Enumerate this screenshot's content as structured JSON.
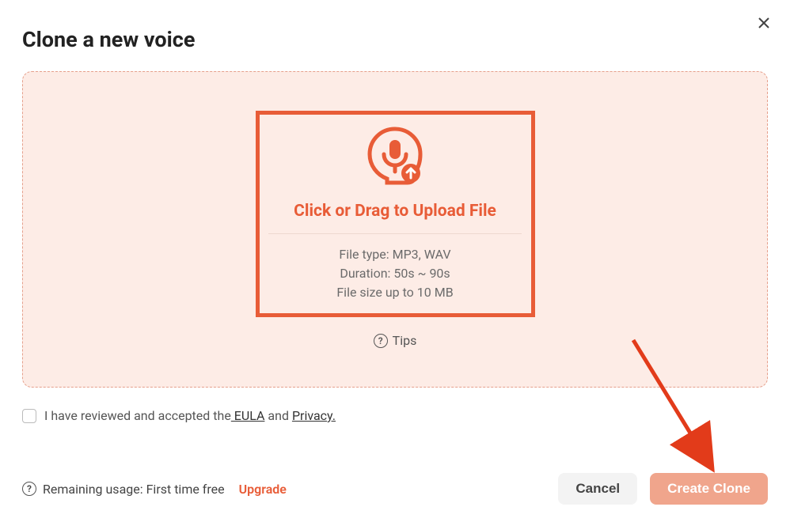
{
  "modal": {
    "title": "Clone a new voice",
    "upload": {
      "title": "Click or Drag to Upload File",
      "req_filetype": "File type: MP3, WAV",
      "req_duration": "Duration: 50s ~ 90s",
      "req_filesize": "File size up to 10 MB"
    },
    "tips_label": "Tips",
    "agree": {
      "prefix": "I have reviewed and accepted the",
      "eula": " EULA",
      "mid": " and ",
      "privacy": "Privacy."
    }
  },
  "footer": {
    "usage_label": "Remaining usage: First time free",
    "upgrade_label": "Upgrade",
    "cancel_label": "Cancel",
    "create_label": "Create Clone"
  }
}
